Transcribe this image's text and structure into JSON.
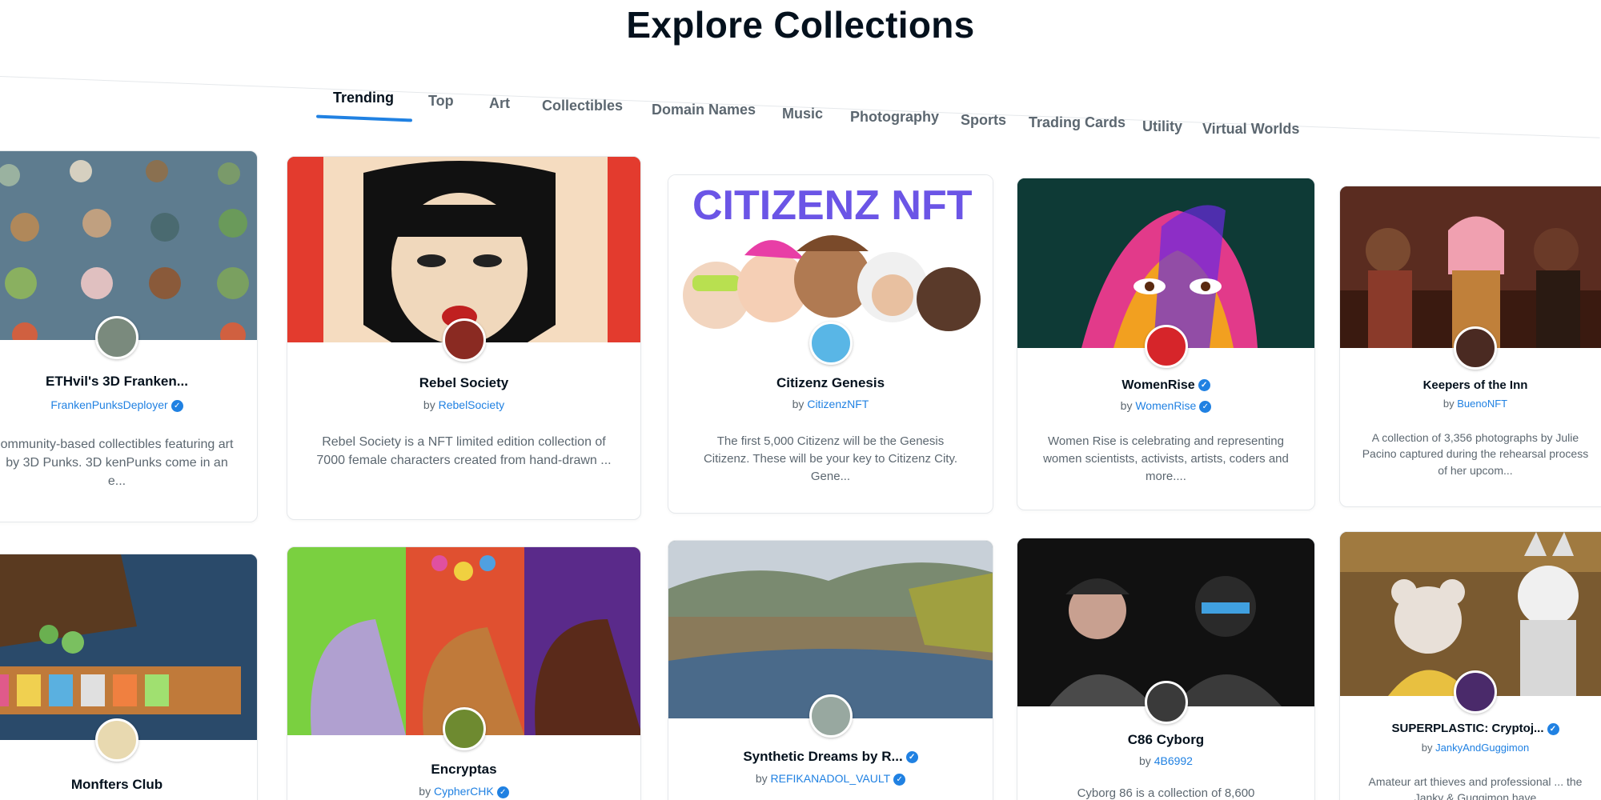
{
  "page": {
    "title": "Explore Collections"
  },
  "tabs": [
    {
      "label": "Trending",
      "active": true
    },
    {
      "label": "Top"
    },
    {
      "label": "Art"
    },
    {
      "label": "Collectibles"
    },
    {
      "label": "Domain Names"
    },
    {
      "label": "Music"
    },
    {
      "label": "Photography"
    },
    {
      "label": "Sports"
    },
    {
      "label": "Trading Cards"
    },
    {
      "label": "Utility"
    },
    {
      "label": "Virtual Worlds"
    }
  ],
  "collections": [
    {
      "name": "ETHvil's 3D Franken...",
      "by": "",
      "creator": "FrankenPunksDeployer",
      "creator_verified": true,
      "description": "ommunity-based collectibles featuring art by 3D Punks. 3D kenPunks come in an e...",
      "colors": {
        "banner": "#5e7c8f",
        "avatar": "#7a8a7d"
      }
    },
    {
      "name": "Rebel Society",
      "by": "by",
      "creator": "RebelSociety",
      "description": "Rebel Society is a NFT limited edition collection of 7000 female characters created from hand-drawn ...",
      "colors": {
        "banner": "#e33b2e",
        "avatar": "#8a2a22"
      }
    },
    {
      "name": "Citizenz Genesis",
      "by": "by",
      "creator": "CitizenzNFT",
      "banner_text": "CITIZENZ NFT",
      "description": "The first 5,000 Citizenz will be the Genesis Citizenz. These will be your key to Citizenz City. Gene...",
      "colors": {
        "banner": "#ffffff",
        "avatar": "#59b6e6",
        "banner_text": "#6b55e6"
      }
    },
    {
      "name": "WomenRise",
      "name_verified": true,
      "by": "by",
      "creator": "WomenRise",
      "creator_verified": true,
      "description": "Women Rise is celebrating and representing women scientists, activists, artists, coders and more....",
      "colors": {
        "banner": "#0e3a36",
        "avatar": "#d6252a"
      }
    },
    {
      "name": "Keepers of the Inn",
      "by": "by",
      "creator": "BuenoNFT",
      "description": "A collection of 3,356 photographs by Julie Pacino captured during the rehearsal process of her upcom...",
      "colors": {
        "banner": "#5a2c20",
        "avatar": "#4a2a22"
      }
    },
    {
      "name": "Monfters Club",
      "by": "",
      "creator": "",
      "description": "",
      "colors": {
        "banner": "#2a4a6a",
        "avatar": "#e8d9b0"
      }
    },
    {
      "name": "Encryptas",
      "by": "by",
      "creator": "CypherCHK",
      "creator_verified": true,
      "description": "",
      "colors": {
        "banner": "#c8a070",
        "avatar": "#6e8a30"
      }
    },
    {
      "name": "Synthetic Dreams by R...",
      "name_verified": true,
      "by": "by",
      "creator": "REFIKANADOL_VAULT",
      "creator_verified": true,
      "description": "",
      "colors": {
        "banner": "#6f7e70",
        "avatar": "#98a8a0"
      }
    },
    {
      "name": "C86 Cyborg",
      "by": "by",
      "creator": "4B6992",
      "description": "Cyborg 86 is a collection of 8,600",
      "colors": {
        "banner": "#111111",
        "avatar": "#3a3a3a"
      }
    },
    {
      "name": "SUPERPLASTIC: Cryptoj...",
      "name_verified": true,
      "by": "by",
      "creator": "JankyAndGuggimon",
      "description": "Amateur art thieves and professional ... the Janky & Guggimon have",
      "colors": {
        "banner": "#7a5a30",
        "avatar": "#4a2a6a"
      }
    }
  ],
  "colors": {
    "accent": "#2081e2",
    "text": "#04111d",
    "muted": "#5c6770",
    "border": "#e5e8eb"
  }
}
